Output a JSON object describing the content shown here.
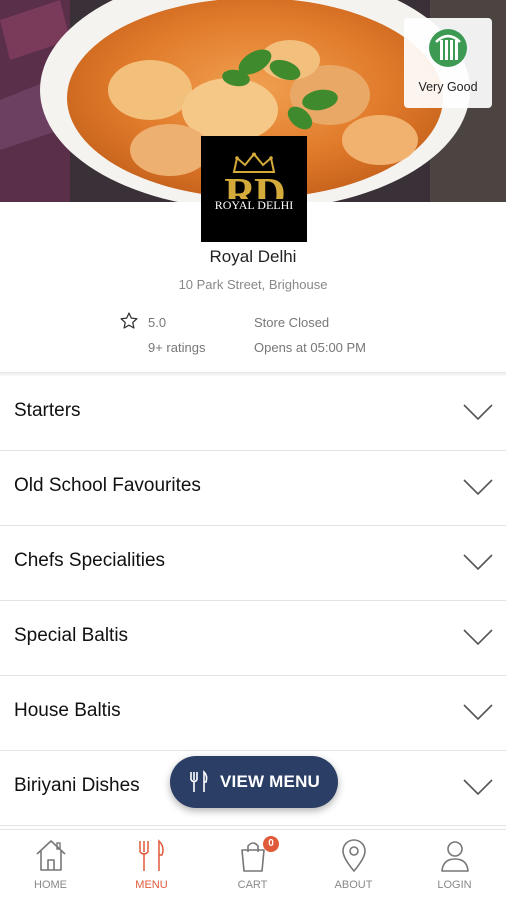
{
  "hygiene": {
    "label": "Very Good"
  },
  "logo": {
    "initials": "RD",
    "brand": "ROYAL DELHI"
  },
  "restaurant": {
    "name": "Royal Delhi",
    "address": "10 Park Street, Brighouse",
    "rating": "5.0",
    "rating_count": "9+ ratings",
    "status": "Store Closed",
    "opens_at": "Opens at 05:00 PM"
  },
  "categories": [
    {
      "label": "Starters"
    },
    {
      "label": "Old School Favourites"
    },
    {
      "label": "Chefs Specialities"
    },
    {
      "label": "Special Baltis"
    },
    {
      "label": "House Baltis"
    },
    {
      "label": "Biriyani Dishes"
    }
  ],
  "view_menu": {
    "label": "VIEW MENU"
  },
  "nav": {
    "items": [
      {
        "label": "HOME",
        "icon": "home-icon"
      },
      {
        "label": "MENU",
        "icon": "cutlery-icon",
        "active": true
      },
      {
        "label": "CART",
        "icon": "shopping-bag-icon",
        "badge": "0"
      },
      {
        "label": "ABOUT",
        "icon": "location-pin-icon"
      },
      {
        "label": "LOGIN",
        "icon": "user-icon"
      }
    ]
  },
  "colors": {
    "accent": "#e05a3a",
    "button": "#2b3e66",
    "logo_gold": "#d4aa3a",
    "hygiene_green": "#3c9a52"
  }
}
